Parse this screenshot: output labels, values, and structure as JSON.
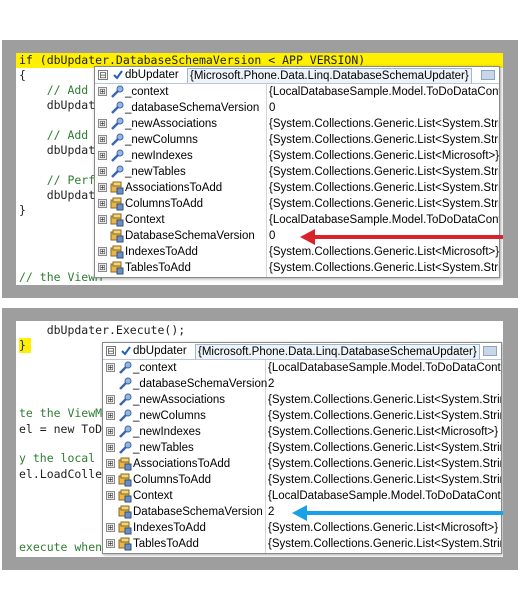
{
  "top_panel": {
    "code_lines": [
      "if (dbUpdater.DatabaseSchemaVersion < APP_VERSION)",
      "{",
      "    // Add th",
      "    dbUpdater",
      "",
      "    // Add th",
      "    dbUpdater",
      "",
      "    // Perfor",
      "    dbUpdater",
      "}",
      "",
      "",
      "// the ViewM"
    ],
    "tooltip": {
      "expander": "⊟",
      "name": "dbUpdater",
      "value": "{Microsoft.Phone.Data.Linq.DatabaseSchemaUpdater}",
      "rows": [
        {
          "expander": "⊞",
          "icon": "property-wrench",
          "name": "_context",
          "value": "{LocalDatabaseSample.Model.ToDoDataContext}"
        },
        {
          "expander": "",
          "icon": "property-wrench",
          "name": "_databaseSchemaVersion",
          "value": "0"
        },
        {
          "expander": "⊞",
          "icon": "property-wrench",
          "name": "_newAssociations",
          "value": "{System.Collections.Generic.List<System.String>}"
        },
        {
          "expander": "⊞",
          "icon": "property-wrench",
          "name": "_newColumns",
          "value": "{System.Collections.Generic.List<System.String>}"
        },
        {
          "expander": "⊞",
          "icon": "property-wrench",
          "name": "_newIndexes",
          "value": "{System.Collections.Generic.List<Microsoft>}"
        },
        {
          "expander": "⊞",
          "icon": "property-wrench",
          "name": "_newTables",
          "value": "{System.Collections.Generic.List<System.String>}"
        },
        {
          "expander": "⊞",
          "icon": "property-hand",
          "name": "AssociationsToAdd",
          "value": "{System.Collections.Generic.List<System.String>}"
        },
        {
          "expander": "⊞",
          "icon": "property-hand",
          "name": "ColumnsToAdd",
          "value": "{System.Collections.Generic.List<System.String>}"
        },
        {
          "expander": "⊞",
          "icon": "property-hand",
          "name": "Context",
          "value": "{LocalDatabaseSample.Model.ToDoDataContext}"
        },
        {
          "expander": "",
          "icon": "property-hand",
          "name": "DatabaseSchemaVersion",
          "value": "0"
        },
        {
          "expander": "⊞",
          "icon": "property-hand",
          "name": "IndexesToAdd",
          "value": "{System.Collections.Generic.List<Microsoft>}"
        },
        {
          "expander": "⊞",
          "icon": "property-hand",
          "name": "TablesToAdd",
          "value": "{System.Collections.Generic.List<System.String>}"
        }
      ]
    },
    "arrow_color": "#d8232a"
  },
  "bottom_panel": {
    "code_lines": [
      "    dbUpdater.Execute();",
      "}",
      "",
      "",
      "te the ViewM",
      "el = new ToD",
      "",
      "y the local",
      "el.LoadColle",
      "",
      "",
      "",
      "execute when"
    ],
    "tooltip": {
      "expander": "⊟",
      "name": "dbUpdater",
      "value": "{Microsoft.Phone.Data.Linq.DatabaseSchemaUpdater}",
      "rows": [
        {
          "expander": "⊞",
          "icon": "property-wrench",
          "name": "_context",
          "value": "{LocalDatabaseSample.Model.ToDoDataContext}"
        },
        {
          "expander": "",
          "icon": "property-wrench",
          "name": "_databaseSchemaVersion",
          "value": "2"
        },
        {
          "expander": "⊞",
          "icon": "property-wrench",
          "name": "_newAssociations",
          "value": "{System.Collections.Generic.List<System.String>}"
        },
        {
          "expander": "⊞",
          "icon": "property-wrench",
          "name": "_newColumns",
          "value": "{System.Collections.Generic.List<System.String>}"
        },
        {
          "expander": "⊞",
          "icon": "property-wrench",
          "name": "_newIndexes",
          "value": "{System.Collections.Generic.List<Microsoft>}"
        },
        {
          "expander": "⊞",
          "icon": "property-wrench",
          "name": "_newTables",
          "value": "{System.Collections.Generic.List<System.String>}"
        },
        {
          "expander": "⊞",
          "icon": "property-hand",
          "name": "AssociationsToAdd",
          "value": "{System.Collections.Generic.List<System.String>}"
        },
        {
          "expander": "⊞",
          "icon": "property-hand",
          "name": "ColumnsToAdd",
          "value": "{System.Collections.Generic.List<System.String>}"
        },
        {
          "expander": "⊞",
          "icon": "property-hand",
          "name": "Context",
          "value": "{LocalDatabaseSample.Model.ToDoDataContext}"
        },
        {
          "expander": "",
          "icon": "property-hand",
          "name": "DatabaseSchemaVersion",
          "value": "2"
        },
        {
          "expander": "⊞",
          "icon": "property-hand",
          "name": "IndexesToAdd",
          "value": "{System.Collections.Generic.List<Microsoft>}"
        },
        {
          "expander": "⊞",
          "icon": "property-hand",
          "name": "TablesToAdd",
          "value": "{System.Collections.Generic.List<System.String>}"
        }
      ]
    },
    "arrow_color": "#1aa0e6"
  }
}
